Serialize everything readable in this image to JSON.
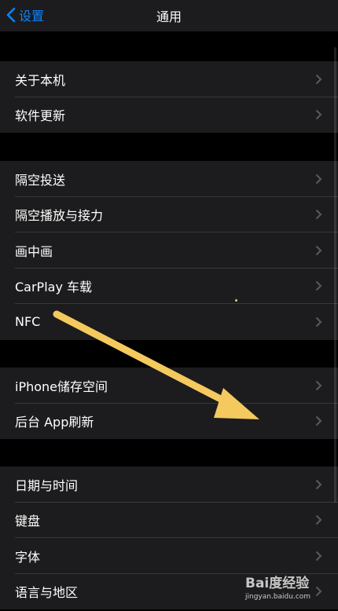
{
  "nav": {
    "back_label": "设置",
    "title": "通用"
  },
  "groups": [
    {
      "items": [
        {
          "label": "关于本机"
        },
        {
          "label": "软件更新"
        }
      ]
    },
    {
      "items": [
        {
          "label": "隔空投送"
        },
        {
          "label": "隔空播放与接力"
        },
        {
          "label": "画中画"
        },
        {
          "label": "CarPlay 车载"
        },
        {
          "label": "NFC"
        }
      ]
    },
    {
      "items": [
        {
          "label": "iPhone储存空间"
        },
        {
          "label": "后台 App刷新"
        }
      ]
    },
    {
      "items": [
        {
          "label": "日期与时间"
        },
        {
          "label": "键盘"
        },
        {
          "label": "字体"
        },
        {
          "label": "语言与地区"
        }
      ]
    }
  ],
  "watermark": {
    "brand": "Bai度经验",
    "url": "jingyan.baidu.com"
  },
  "colors": {
    "accent": "#0a84ff",
    "cell": "#1c1c1e",
    "background": "#000000",
    "arrow": "#f4c95d"
  }
}
